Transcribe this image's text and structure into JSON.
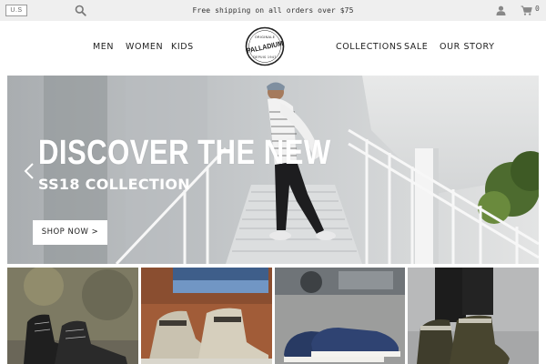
{
  "topbar": {
    "region": "U.S",
    "promo": "Free shipping on all orders over $75",
    "cart_count": "0",
    "icons": [
      "search-icon",
      "user-icon",
      "cart-icon"
    ]
  },
  "nav": {
    "left_links": [
      "MEN",
      "WOMEN",
      "KIDS"
    ],
    "right_links": [
      "COLLECTIONS",
      "SALE",
      "OUR STORY"
    ],
    "logo": {
      "top_text": "ORIGINALE",
      "brand": "PALLADIUM",
      "bottom_text": "DEPUIS 1947"
    }
  },
  "hero": {
    "title": "DISCOVER THE NEW",
    "subtitle": "SS18 COLLECTION",
    "cta": "SHOP NOW >"
  },
  "tiles": [
    "black-boots-tile",
    "beige-boots-tile",
    "navy-sneakers-tile",
    "olive-boots-tile"
  ],
  "colors": {
    "topbar_bg": "#efefef",
    "text": "#222222",
    "hero_text": "#ffffff",
    "button_bg": "#ffffff"
  }
}
